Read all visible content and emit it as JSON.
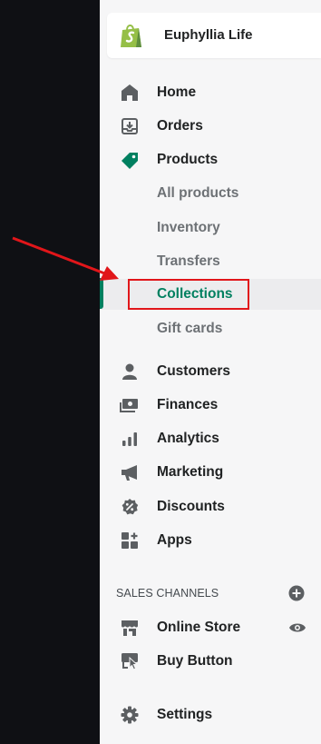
{
  "store": {
    "name": "Euphyllia Life",
    "icon": "shopify-bag-icon",
    "brand_color": "#95bf47"
  },
  "nav": {
    "items": [
      {
        "label": "Home",
        "icon": "home-icon"
      },
      {
        "label": "Orders",
        "icon": "orders-icon"
      },
      {
        "label": "Products",
        "icon": "tag-icon"
      }
    ],
    "product_subitems": [
      {
        "label": "All products"
      },
      {
        "label": "Inventory"
      },
      {
        "label": "Transfers"
      },
      {
        "label": "Collections",
        "active": true
      },
      {
        "label": "Gift cards"
      }
    ],
    "more_items": [
      {
        "label": "Customers",
        "icon": "person-icon"
      },
      {
        "label": "Finances",
        "icon": "finances-icon"
      },
      {
        "label": "Analytics",
        "icon": "bar-chart-icon"
      },
      {
        "label": "Marketing",
        "icon": "megaphone-icon"
      },
      {
        "label": "Discounts",
        "icon": "discount-icon"
      },
      {
        "label": "Apps",
        "icon": "apps-icon"
      }
    ]
  },
  "sales_channels": {
    "title": "SALES CHANNELS",
    "add_icon": "plus-circle-icon",
    "items": [
      {
        "label": "Online Store",
        "icon": "store-icon",
        "action_icon": "eye-icon"
      },
      {
        "label": "Buy Button",
        "icon": "buy-button-icon"
      }
    ]
  },
  "settings": {
    "label": "Settings",
    "icon": "gear-icon"
  },
  "colors": {
    "active_green": "#008060",
    "annotation_red": "#e1161a",
    "sidebar_bg": "#f6f6f7",
    "page_bg": "#0f1014"
  }
}
